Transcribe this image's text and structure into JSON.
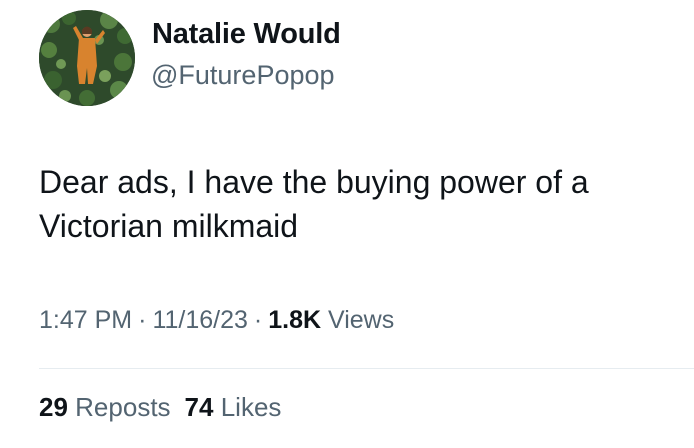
{
  "author": {
    "display_name": "Natalie Would",
    "handle": "@FuturePopop",
    "avatar_icon": "profile-photo"
  },
  "tweet": {
    "text_line1": "Dear ads, I have the buying power of a",
    "text_line2": "Victorian milkmaid"
  },
  "meta": {
    "time": "1:47 PM",
    "separator": "·",
    "date": "11/16/23",
    "views_count": "1.8K",
    "views_label": "Views"
  },
  "stats": {
    "reposts_count": "29",
    "reposts_label": "Reposts",
    "likes_count": "74",
    "likes_label": "Likes"
  },
  "colors": {
    "primary_text": "#0f1419",
    "secondary_text": "#536471",
    "divider": "#e6ecf0"
  }
}
